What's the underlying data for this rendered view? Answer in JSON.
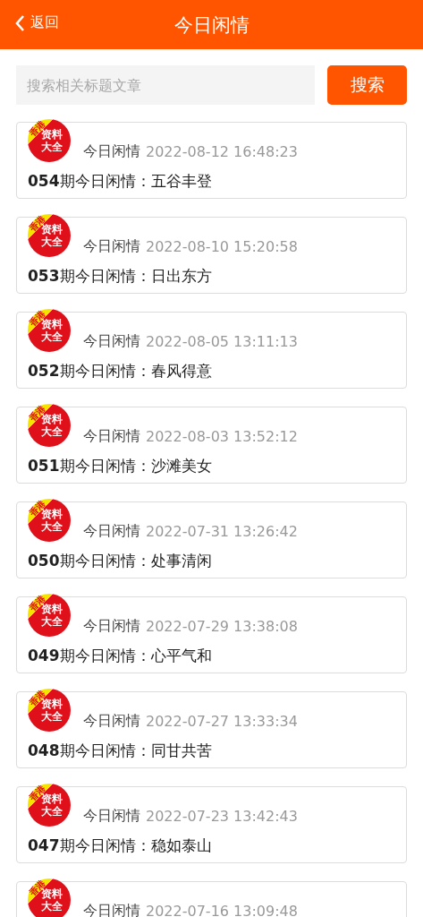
{
  "header": {
    "back": "返回",
    "title": "今日闲情"
  },
  "search": {
    "placeholder": "搜索相关标题文章",
    "button": "搜索"
  },
  "items": [
    {
      "badge_corner": "香港",
      "badge_top": "资料",
      "badge_bottom": "大全",
      "category": "今日闲情",
      "time": "2022-08-12 16:48:23",
      "title": "**054**期今日闲情：五谷丰登"
    },
    {
      "badge_corner": "香港",
      "badge_top": "资料",
      "badge_bottom": "大全",
      "category": "今日闲情",
      "time": "2022-08-10 15:20:58",
      "title": "**053**期今日闲情：日出东方"
    },
    {
      "badge_corner": "香港",
      "badge_top": "资料",
      "badge_bottom": "大全",
      "category": "今日闲情",
      "time": "2022-08-05 13:11:13",
      "title": "**052**期今日闲情：春风得意"
    },
    {
      "badge_corner": "香港",
      "badge_top": "资料",
      "badge_bottom": "大全",
      "category": "今日闲情",
      "time": "2022-08-03 13:52:12",
      "title": "**051**期今日闲情：沙滩美女"
    },
    {
      "badge_corner": "香港",
      "badge_top": "资料",
      "badge_bottom": "大全",
      "category": "今日闲情",
      "time": "2022-07-31 13:26:42",
      "title": "**050**期今日闲情：处事清闲"
    },
    {
      "badge_corner": "香港",
      "badge_top": "资料",
      "badge_bottom": "大全",
      "category": "今日闲情",
      "time": "2022-07-29 13:38:08",
      "title": "**049**期今日闲情：心平气和"
    },
    {
      "badge_corner": "香港",
      "badge_top": "资料",
      "badge_bottom": "大全",
      "category": "今日闲情",
      "time": "2022-07-27 13:33:34",
      "title": "**048**期今日闲情：同甘共苦"
    },
    {
      "badge_corner": "香港",
      "badge_top": "资料",
      "badge_bottom": "大全",
      "category": "今日闲情",
      "time": "2022-07-23 13:42:43",
      "title": "**047**期今日闲情：稳如泰山"
    },
    {
      "badge_corner": "香港",
      "badge_top": "资料",
      "badge_bottom": "大全",
      "category": "今日闲情",
      "time": "2022-07-16 13:09:48"
    }
  ]
}
